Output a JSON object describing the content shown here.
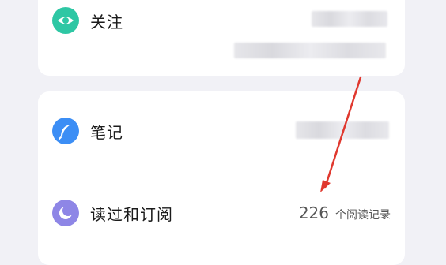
{
  "items": [
    {
      "label": "关注",
      "icon": "eye-icon",
      "color": "#2ec7a4"
    },
    {
      "label": "笔记",
      "icon": "feather-icon",
      "color": "#3c8ef5"
    },
    {
      "label": "读过和订阅",
      "icon": "moon-icon",
      "color": "#8e86e6"
    }
  ],
  "read_count": {
    "number": "226",
    "unit": "个阅读记录"
  },
  "colors": {
    "background": "#f1f1f6",
    "card": "#ffffff",
    "arrow": "#e0382e"
  }
}
